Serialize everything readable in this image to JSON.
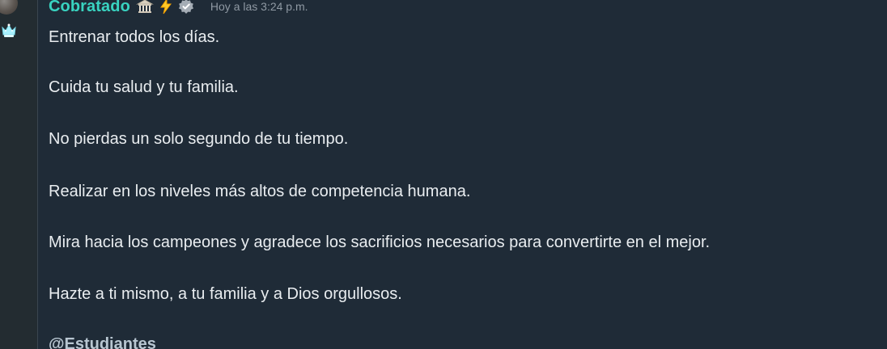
{
  "message": {
    "author": "Cobratado",
    "timestamp": "Hoy a las 3:24 p.m.",
    "lines": [
      "Entrenar todos los días.",
      "Cuida tu salud y tu familia.",
      "No pierdas un solo segundo de tu tiempo.",
      "Realizar en los niveles más altos de competencia humana.",
      "Mira hacia los campeones y agradece los sacrificios necesarios para convertirte en el mejor.",
      "Hazte a ti mismo, a tu familia y a Dios orgullosos."
    ],
    "mention": "@Estudiantes"
  },
  "icons": {
    "avatar": "user-avatar",
    "crown": "crown-icon",
    "bank": "bank-icon",
    "lightning": "lightning-icon",
    "verified": "verified-badge-icon"
  },
  "colors": {
    "background": "#1f2b37",
    "author": "#39d3c0",
    "text": "#e9edf0",
    "timestamp": "#8f99a3",
    "mention": "#b8c6d1"
  }
}
